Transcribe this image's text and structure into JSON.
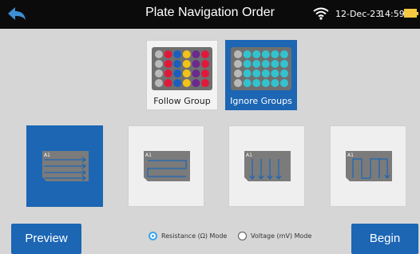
{
  "header": {
    "title": "Plate Navigation Order",
    "date": "12-Dec-23",
    "time": "14:59",
    "icons": {
      "back": "back-arrow-icon",
      "wifi": "wifi-icon",
      "battery": "battery-icon"
    }
  },
  "groups": {
    "follow_label": "Follow Group",
    "ignore_label": "Ignore Groups",
    "selected": "Ignore Groups",
    "follow_row_colors": [
      "#e0193c",
      "#1a5fbf",
      "#f4c21b",
      "#6a2a8f"
    ],
    "ignore_color": "#32c3cf"
  },
  "patterns": {
    "well_label": "A1",
    "items": [
      "rows-left-to-right",
      "rows-serpentine",
      "columns-top-to-bottom",
      "columns-serpentine"
    ],
    "selected_index": 0
  },
  "mode": {
    "resistance_label": "Resistance (Ω) Mode",
    "voltage_label": "Voltage (mV) Mode",
    "selected": "Resistance (Ω) Mode"
  },
  "buttons": {
    "preview": "Preview",
    "begin": "Begin"
  },
  "colors": {
    "accent": "#1c66b4",
    "radio_on": "#3aa4e8"
  }
}
